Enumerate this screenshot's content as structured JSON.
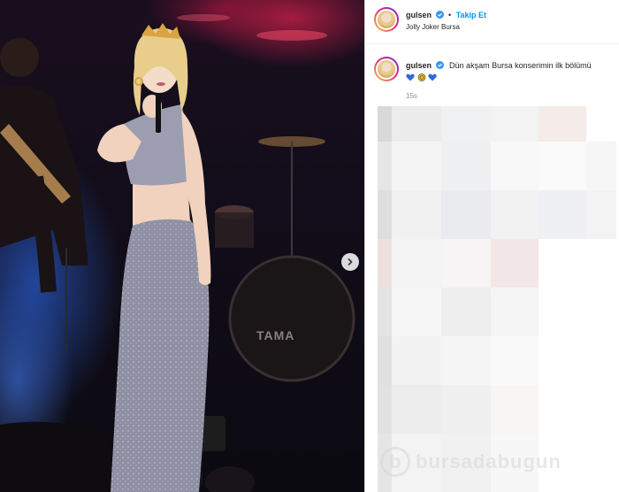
{
  "post": {
    "username": "gulsen",
    "follow_label": "Takip Et",
    "separator": "•",
    "location": "Jolly Joker Bursa"
  },
  "caption": {
    "username": "gulsen",
    "text": "Dün akşam Bursa konserimin ilk bölümü",
    "emojis": [
      "blue-heart",
      "yellow-circle-emoji",
      "blue-heart"
    ],
    "time_ago": "15s"
  },
  "photo": {
    "drum_brand": "TAMA"
  },
  "colors": {
    "link_blue": "#0095f6",
    "verified_blue": "#3897f0",
    "emoji_blue": "#2f6bd6",
    "emoji_yellow": "#e8b923"
  },
  "watermark": {
    "logo_letter": "b",
    "text": "bursadabugun"
  }
}
